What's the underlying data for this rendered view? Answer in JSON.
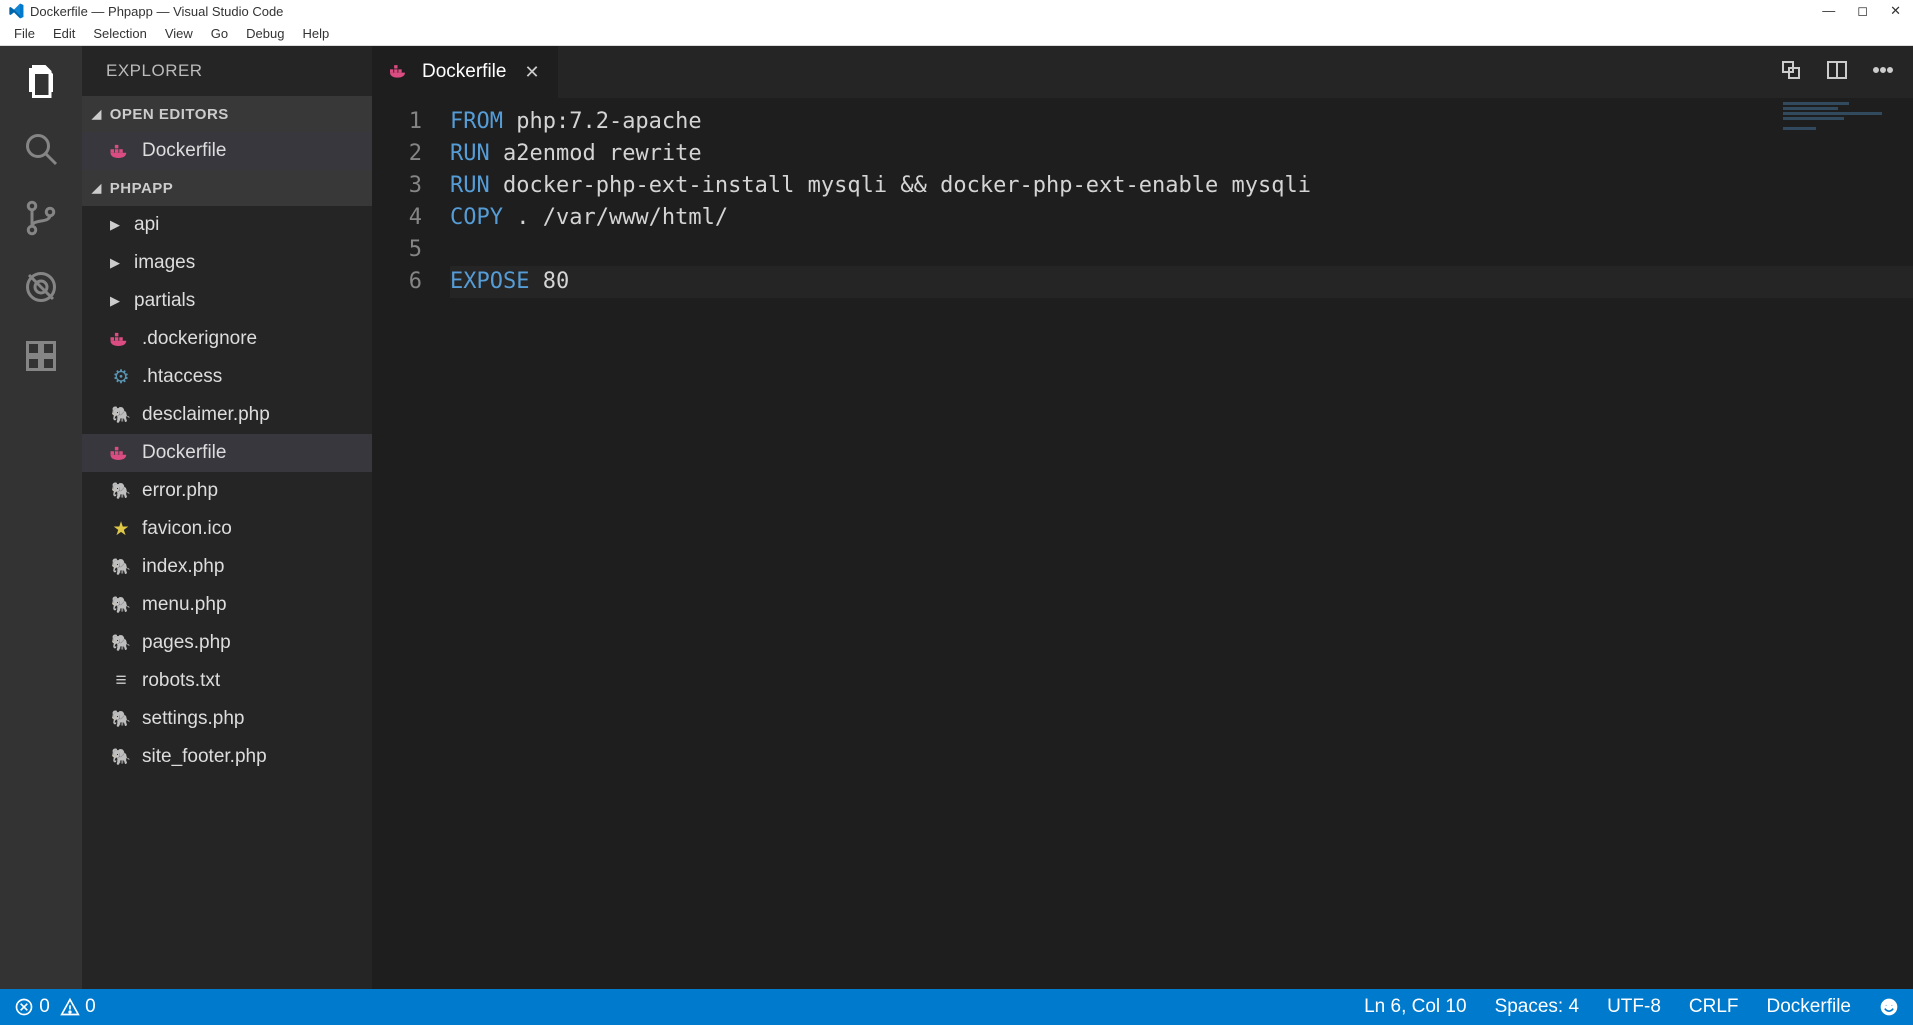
{
  "titlebar": {
    "title": "Dockerfile — Phpapp — Visual Studio Code"
  },
  "menubar": [
    "File",
    "Edit",
    "Selection",
    "View",
    "Go",
    "Debug",
    "Help"
  ],
  "sidebar": {
    "title": "EXPLORER",
    "sections": {
      "openEditors": {
        "label": "OPEN EDITORS",
        "items": [
          {
            "label": "Dockerfile",
            "icon": "docker-icon",
            "active": true
          }
        ]
      },
      "project": {
        "label": "PHPAPP",
        "items": [
          {
            "label": "api",
            "type": "folder"
          },
          {
            "label": "images",
            "type": "folder"
          },
          {
            "label": "partials",
            "type": "folder"
          },
          {
            "label": ".dockerignore",
            "type": "file",
            "icon": "docker-icon"
          },
          {
            "label": ".htaccess",
            "type": "file",
            "icon": "gear-icon"
          },
          {
            "label": "desclaimer.php",
            "type": "file",
            "icon": "php-icon"
          },
          {
            "label": "Dockerfile",
            "type": "file",
            "icon": "docker-icon",
            "active": true
          },
          {
            "label": "error.php",
            "type": "file",
            "icon": "php-icon"
          },
          {
            "label": "favicon.ico",
            "type": "file",
            "icon": "star-icon"
          },
          {
            "label": "index.php",
            "type": "file",
            "icon": "php-icon"
          },
          {
            "label": "menu.php",
            "type": "file",
            "icon": "php-icon"
          },
          {
            "label": "pages.php",
            "type": "file",
            "icon": "php-icon"
          },
          {
            "label": "robots.txt",
            "type": "file",
            "icon": "lines-icon"
          },
          {
            "label": "settings.php",
            "type": "file",
            "icon": "php-icon"
          },
          {
            "label": "site_footer.php",
            "type": "file",
            "icon": "php-icon"
          }
        ]
      }
    }
  },
  "tab": {
    "label": "Dockerfile",
    "icon": "docker-icon"
  },
  "code": {
    "lines": [
      {
        "n": 1,
        "tokens": [
          {
            "t": "FROM",
            "c": "kw"
          },
          {
            "t": " php:7.2-apache",
            "c": ""
          }
        ]
      },
      {
        "n": 2,
        "tokens": [
          {
            "t": "RUN",
            "c": "kw"
          },
          {
            "t": " a2enmod rewrite",
            "c": ""
          }
        ]
      },
      {
        "n": 3,
        "tokens": [
          {
            "t": "RUN",
            "c": "kw"
          },
          {
            "t": " docker-php-ext-install mysqli && docker-php-ext-enable mysqli",
            "c": ""
          }
        ]
      },
      {
        "n": 4,
        "tokens": [
          {
            "t": "COPY",
            "c": "kw"
          },
          {
            "t": " . /var/www/html/",
            "c": ""
          }
        ]
      },
      {
        "n": 5,
        "tokens": []
      },
      {
        "n": 6,
        "tokens": [
          {
            "t": "EXPOSE",
            "c": "kw"
          },
          {
            "t": " 80",
            "c": ""
          }
        ],
        "current": true
      }
    ]
  },
  "statusbar": {
    "errors": "0",
    "warnings": "0",
    "cursor": "Ln 6, Col 10",
    "spaces": "Spaces: 4",
    "encoding": "UTF-8",
    "eol": "CRLF",
    "language": "Dockerfile"
  }
}
